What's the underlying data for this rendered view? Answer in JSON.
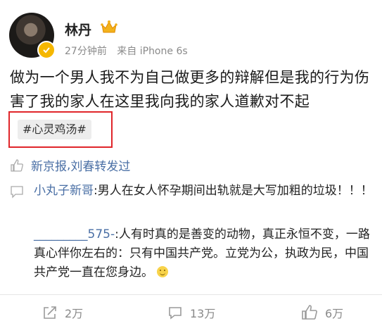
{
  "post": {
    "author": "林丹",
    "time": "27分钟前",
    "source": "来自 iPhone 6s",
    "text": "做为一个男人我不为自己做更多的辩解但是我的行为伤害了我的家人在这里我向我的家人道歉对不起",
    "hashtag": "#心灵鸡汤#"
  },
  "reposts": {
    "user1": "新京报",
    "separator": ",",
    "user2": "刘春",
    "suffix": "转发过"
  },
  "comments": [
    {
      "user": "小丸子新哥",
      "text": ":男人在女人怀孕期间出轨就是大写加粗的垃圾！！！"
    },
    {
      "user": "_________575-",
      "text": ":人有时真的是善变的动物，真正永恒不变，一路真心伴你左右的：只有中国共产党。立党为公，执政为民，中国共产党一直在您身边。"
    }
  ],
  "actions": {
    "forward_count": "2万",
    "comment_count": "13万",
    "like_count": "6万"
  },
  "colors": {
    "link": "#4a6fa5",
    "highlight_border": "#e0262a",
    "muted": "#8a8a8a"
  },
  "icons": [
    "crown-icon",
    "verified-icon",
    "thumbs-up-icon",
    "comment-icon",
    "forward-icon",
    "smile-emoji-icon"
  ]
}
